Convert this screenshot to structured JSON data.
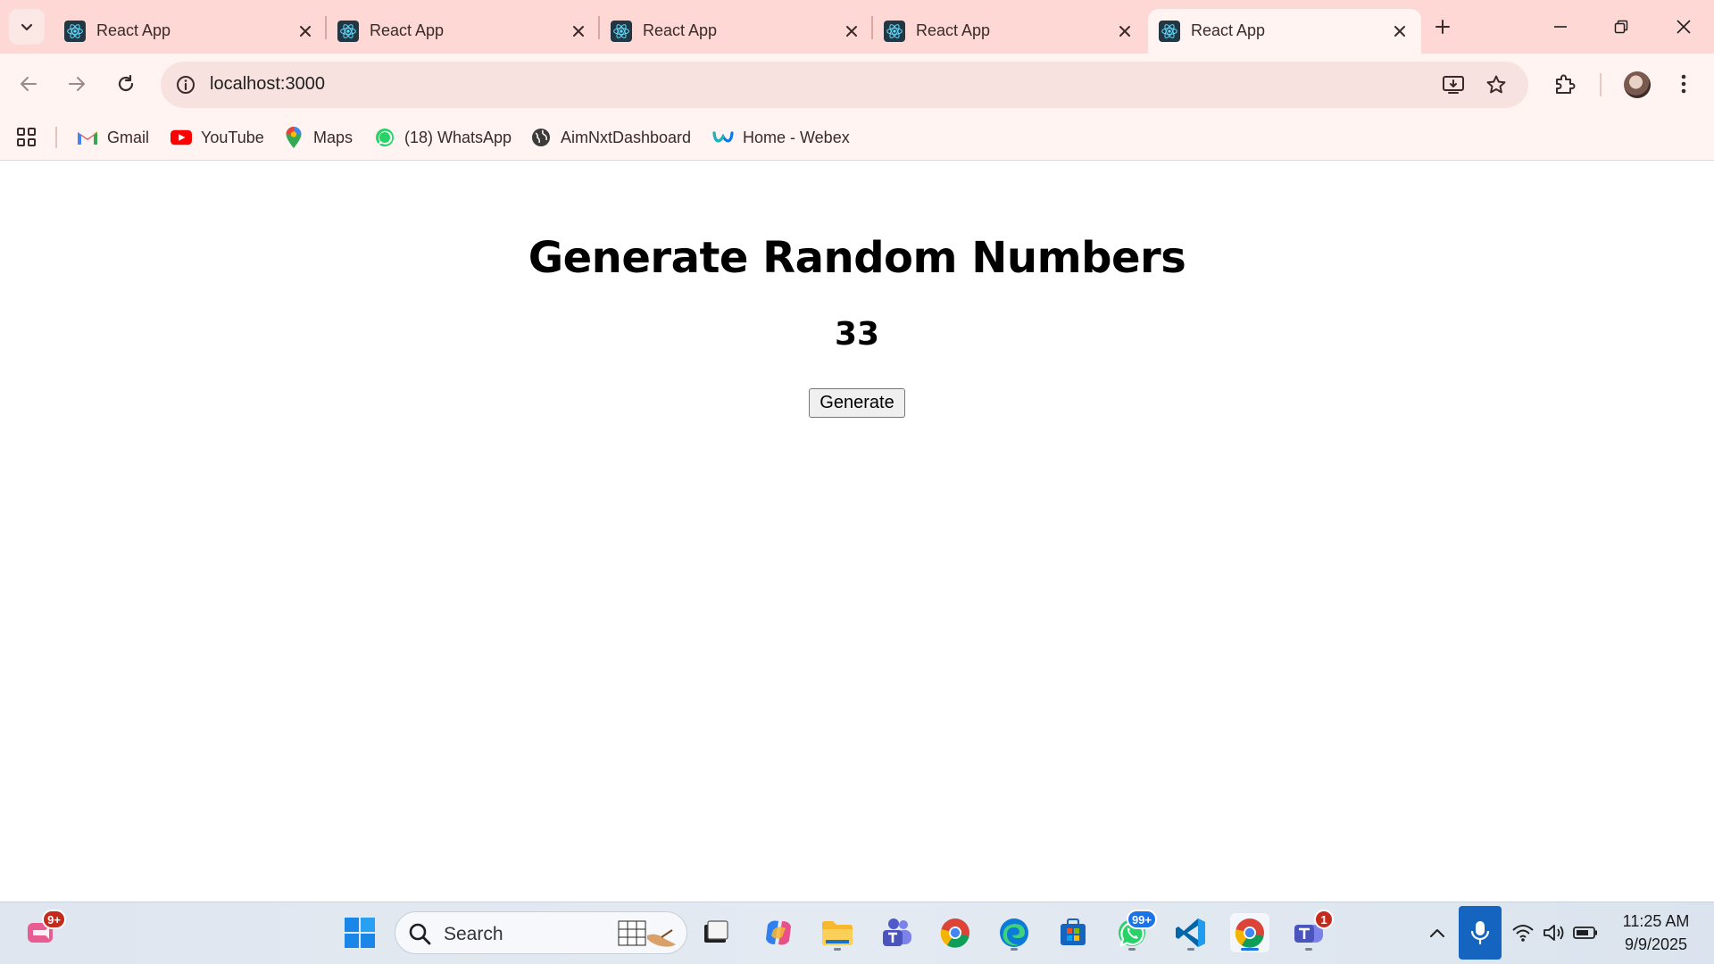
{
  "browser": {
    "tabs": [
      {
        "label": "React App",
        "active": false
      },
      {
        "label": "React App",
        "active": false
      },
      {
        "label": "React App",
        "active": false
      },
      {
        "label": "React App",
        "active": false
      },
      {
        "label": "React App",
        "active": true
      }
    ],
    "url": "localhost:3000",
    "bookmarks": [
      {
        "label": "Gmail",
        "icon": "gmail-icon"
      },
      {
        "label": "YouTube",
        "icon": "youtube-icon"
      },
      {
        "label": "Maps",
        "icon": "maps-icon"
      },
      {
        "label": "(18) WhatsApp",
        "icon": "whatsapp-icon"
      },
      {
        "label": "AimNxtDashboard",
        "icon": "globe-icon"
      },
      {
        "label": "Home - Webex",
        "icon": "webex-icon"
      }
    ],
    "colors": {
      "frame": "#fdd8d4",
      "toolbar": "#fff4f2",
      "omnibox": "#f7e2df"
    }
  },
  "page": {
    "title": "Generate Random Numbers",
    "value": "33",
    "button_label": "Generate"
  },
  "taskbar": {
    "search_placeholder": "Search",
    "badges": {
      "left_widget": "9+",
      "whatsapp": "99+",
      "teams": "1"
    },
    "time": "11:25 AM",
    "date": "9/9/2025"
  }
}
